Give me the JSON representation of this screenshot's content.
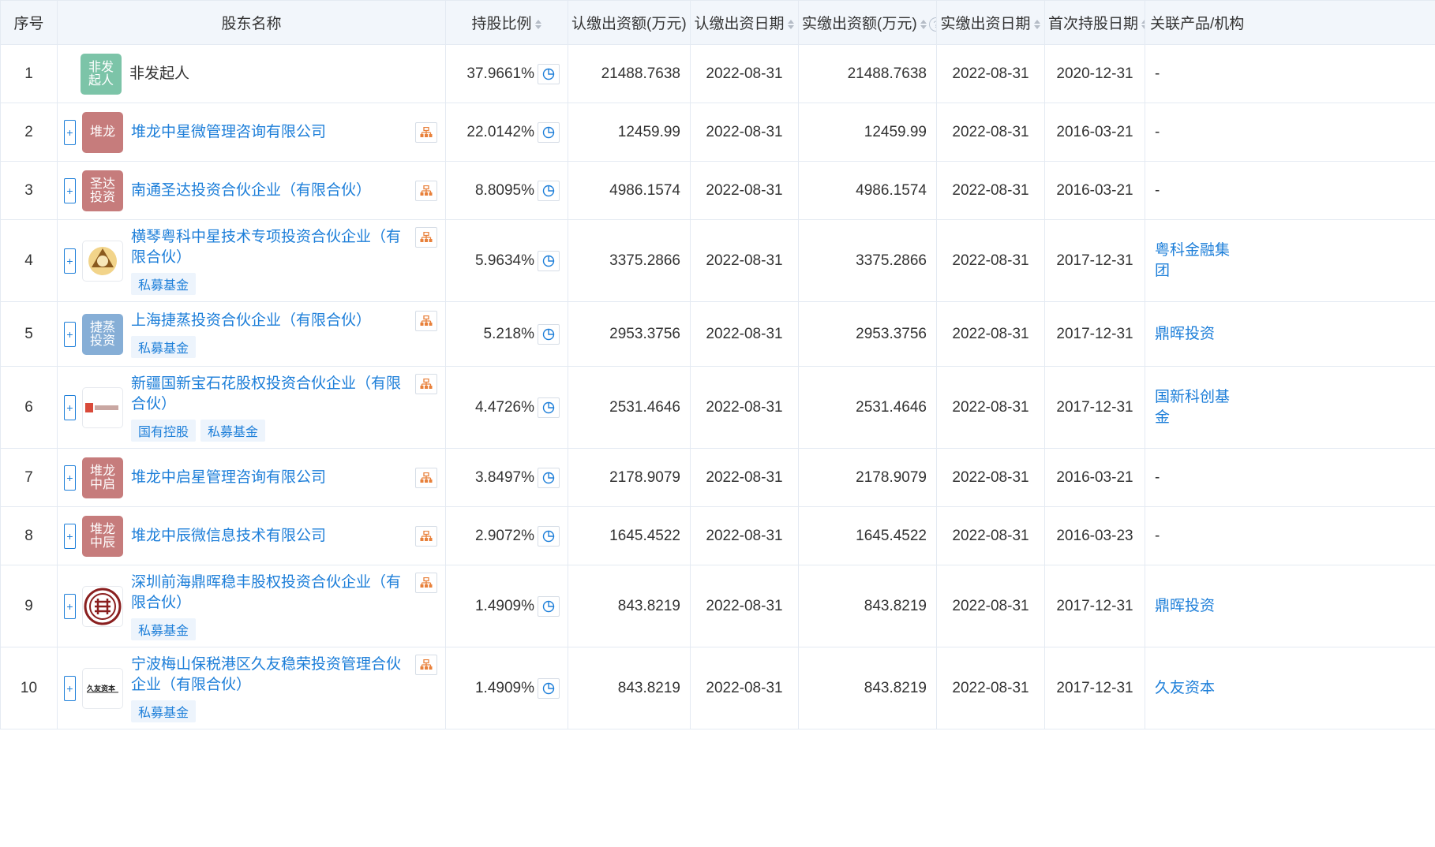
{
  "headers": {
    "index": "序号",
    "name": "股东名称",
    "ratio": "持股比例",
    "subscribed_amount": "认缴出资额(万元)",
    "subscribed_date": "认缴出资日期",
    "paid_amount": "实缴出资额(万元)",
    "paid_date": "实缴出资日期",
    "first_date": "首次持股日期",
    "related": "关联产品/机构"
  },
  "rows": [
    {
      "index": "1",
      "logo_text": "非发\n起人",
      "logo_color": "#7cc4a8",
      "name": "非发起人",
      "ratio": "37.9661%",
      "sub_amount": "21488.7638",
      "sub_date": "2022-08-31",
      "paid_amount": "21488.7638",
      "paid_date": "2022-08-31",
      "first_date": "2020-12-31",
      "related": "-"
    },
    {
      "index": "2",
      "logo_text": "堆龙",
      "logo_color": "#c67c7c",
      "name": "堆龙中星微管理咨询有限公司",
      "ratio": "22.0142%",
      "sub_amount": "12459.99",
      "sub_date": "2022-08-31",
      "paid_amount": "12459.99",
      "paid_date": "2022-08-31",
      "first_date": "2016-03-21",
      "related": "-"
    },
    {
      "index": "3",
      "logo_text": "圣达\n投资",
      "logo_color": "#c67c7c",
      "name": "南通圣达投资合伙企业（有限合伙）",
      "ratio": "8.8095%",
      "sub_amount": "4986.1574",
      "sub_date": "2022-08-31",
      "paid_amount": "4986.1574",
      "paid_date": "2022-08-31",
      "first_date": "2016-03-21",
      "related": "-"
    },
    {
      "index": "4",
      "logo_text": "",
      "logo_color": "#ffffff",
      "name": "横琴粤科中星技术专项投资合伙企业（有限合伙）",
      "tags": [
        "私募基金"
      ],
      "ratio": "5.9634%",
      "sub_amount": "3375.2866",
      "sub_date": "2022-08-31",
      "paid_amount": "3375.2866",
      "paid_date": "2022-08-31",
      "first_date": "2017-12-31",
      "related": "粤科金融集团"
    },
    {
      "index": "5",
      "logo_text": "捷蒸\n投资",
      "logo_color": "#86aed6",
      "name": "上海捷蒸投资合伙企业（有限合伙）",
      "tags": [
        "私募基金"
      ],
      "ratio": "5.218%",
      "sub_amount": "2953.3756",
      "sub_date": "2022-08-31",
      "paid_amount": "2953.3756",
      "paid_date": "2022-08-31",
      "first_date": "2017-12-31",
      "related": "鼎晖投资"
    },
    {
      "index": "6",
      "logo_text": "",
      "logo_color": "#ffffff",
      "name": "新疆国新宝石花股权投资合伙企业（有限合伙）",
      "tags": [
        "国有控股",
        "私募基金"
      ],
      "ratio": "4.4726%",
      "sub_amount": "2531.4646",
      "sub_date": "2022-08-31",
      "paid_amount": "2531.4646",
      "paid_date": "2022-08-31",
      "first_date": "2017-12-31",
      "related": "国新科创基金"
    },
    {
      "index": "7",
      "logo_text": "堆龙\n中启",
      "logo_color": "#c67c7c",
      "name": "堆龙中启星管理咨询有限公司",
      "ratio": "3.8497%",
      "sub_amount": "2178.9079",
      "sub_date": "2022-08-31",
      "paid_amount": "2178.9079",
      "paid_date": "2022-08-31",
      "first_date": "2016-03-21",
      "related": "-"
    },
    {
      "index": "8",
      "logo_text": "堆龙\n中辰",
      "logo_color": "#c67c7c",
      "name": "堆龙中辰微信息技术有限公司",
      "ratio": "2.9072%",
      "sub_amount": "1645.4522",
      "sub_date": "2022-08-31",
      "paid_amount": "1645.4522",
      "paid_date": "2022-08-31",
      "first_date": "2016-03-23",
      "related": "-"
    },
    {
      "index": "9",
      "logo_text": "",
      "logo_color": "#ffffff",
      "name": "深圳前海鼎晖稳丰股权投资合伙企业（有限合伙）",
      "tags": [
        "私募基金"
      ],
      "ratio": "1.4909%",
      "sub_amount": "843.8219",
      "sub_date": "2022-08-31",
      "paid_amount": "843.8219",
      "paid_date": "2022-08-31",
      "first_date": "2017-12-31",
      "related": "鼎晖投资"
    },
    {
      "index": "10",
      "logo_text": "",
      "logo_color": "#ffffff",
      "name": "宁波梅山保税港区久友稳荣投资管理合伙企业（有限合伙）",
      "tags": [
        "私募基金"
      ],
      "ratio": "1.4909%",
      "sub_amount": "843.8219",
      "sub_date": "2022-08-31",
      "paid_amount": "843.8219",
      "paid_date": "2022-08-31",
      "first_date": "2017-12-31",
      "related": "久友资本"
    }
  ],
  "colors": {
    "link": "#1e7fd9",
    "header_bg": "#f2f6fb",
    "tag_bg": "#edf4fc",
    "struct_icon": "#e8803a"
  },
  "icons": {
    "pie": "pie-chart-icon",
    "structure": "equity-structure-icon",
    "expand": "plus-icon",
    "help": "question-icon",
    "sort": "sort-icon"
  }
}
